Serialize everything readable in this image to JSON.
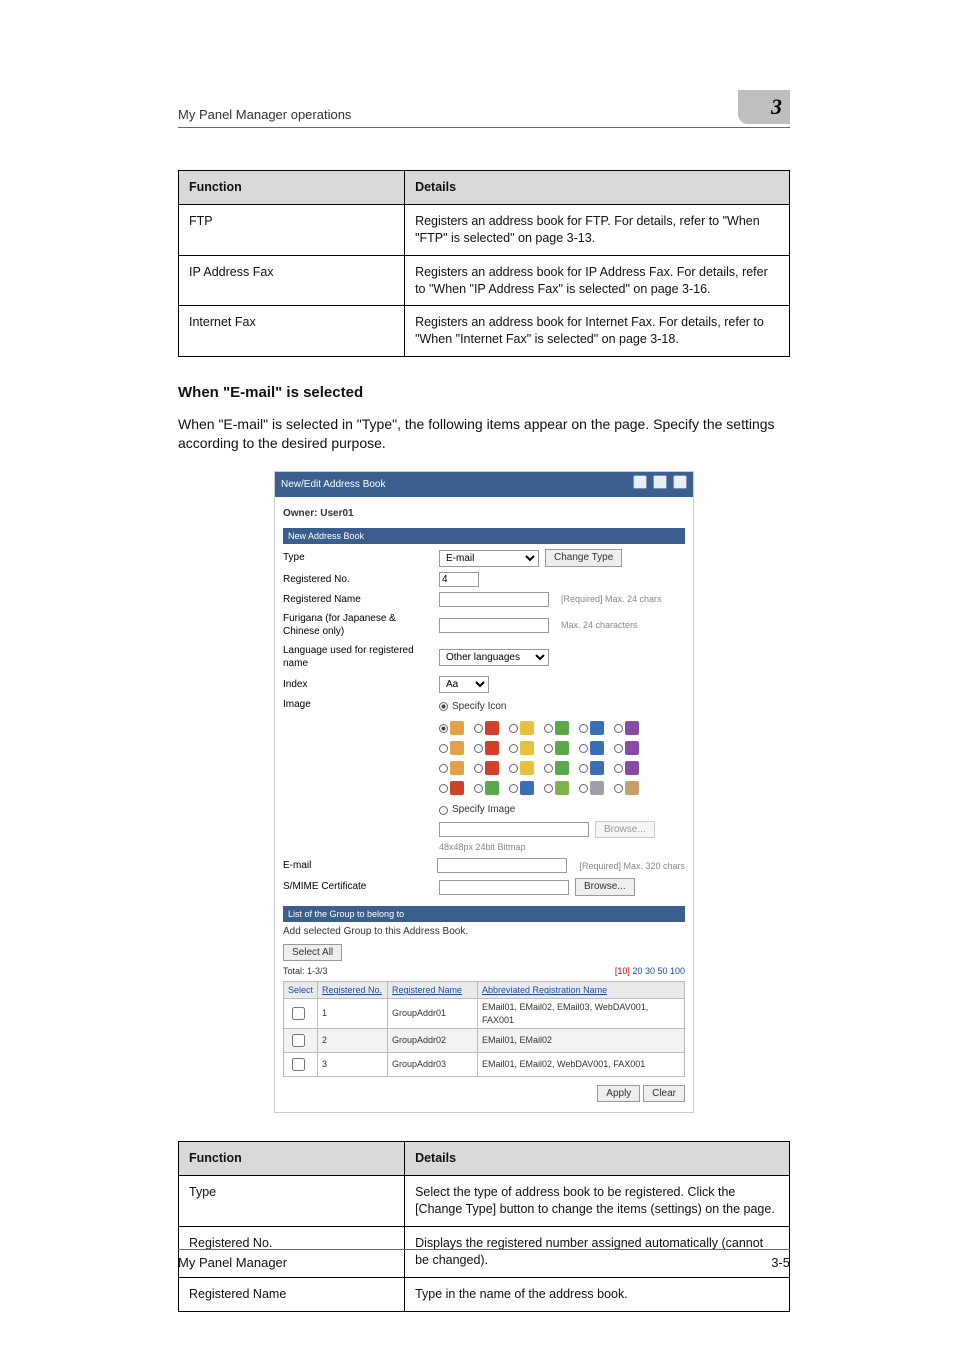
{
  "header": {
    "running_title": "My Panel Manager operations",
    "chapter_number": "3"
  },
  "tables": {
    "top": {
      "head": {
        "fn": "Function",
        "det": "Details"
      },
      "rows": [
        {
          "fn": "FTP",
          "det": "Registers an address book for FTP. For details, refer to \"When \"FTP\" is selected\" on page 3-13."
        },
        {
          "fn": "IP Address Fax",
          "det": "Registers an address book for IP Address Fax. For details, refer to \"When \"IP Address Fax\" is selected\" on page 3-16."
        },
        {
          "fn": "Internet Fax",
          "det": "Registers an address book for Internet Fax. For details, refer to \"When \"Internet Fax\" is selected\" on page 3-18."
        }
      ]
    },
    "bottom": {
      "head": {
        "fn": "Function",
        "det": "Details"
      },
      "rows": [
        {
          "fn": "Type",
          "det": "Select the type of address book to be registered. Click the [Change Type] button to change the items (settings) on the page."
        },
        {
          "fn": "Registered No.",
          "det": "Displays the registered number assigned automatically (cannot be changed)."
        },
        {
          "fn": "Registered Name",
          "det": "Type in the name of the address book."
        }
      ]
    }
  },
  "section": {
    "heading": "When \"E-mail\" is selected",
    "paragraph": "When \"E-mail\" is selected in \"Type\", the following items appear on the page. Specify the settings according to the desired purpose."
  },
  "shot": {
    "titlebar": "New/Edit Address Book",
    "owner": "Owner: User01",
    "sub1": "New Address Book",
    "type_lbl": "Type",
    "type_val": "E-mail",
    "change_type_btn": "Change Type",
    "regno_lbl": "Registered No.",
    "regno_val": "4",
    "regname_lbl": "Registered Name",
    "regname_hint": "[Required] Max. 24 chars",
    "furigana_lbl": "Furigana (for Japanese & Chinese only)",
    "furigana_hint": "Max. 24 characters",
    "lang_lbl": "Language used for registered name",
    "lang_val": "Other languages",
    "index_lbl": "Index",
    "index_val": "Aa",
    "image_lbl": "Image",
    "specify_icon": "Specify Icon",
    "specify_image": "Specify Image",
    "browse_btn": "Browse...",
    "bitmap_note": "48x48px 24bit Bitmap",
    "email_lbl": "E-mail",
    "email_hint": "[Required] Max. 320 chars",
    "smime_lbl": "S/MIME Certificate",
    "sub2": "List of the Group to belong to",
    "sub2_note": "Add selected Group to this Address Book.",
    "select_all_btn": "Select All",
    "total_lbl": "Total:",
    "total_range": "1-3/3",
    "pager": "[10] 20 30 50 100",
    "grid_head": {
      "sel": "Select",
      "no": "Registered No.",
      "name": "Registered Name",
      "abbr": "Abbreviated Registration Name"
    },
    "grid_rows": [
      {
        "no": "1",
        "name": "GroupAddr01",
        "abbr": "EMail01, EMail02, EMail03, WebDAV001, FAX001"
      },
      {
        "no": "2",
        "name": "GroupAddr02",
        "abbr": "EMail01, EMail02"
      },
      {
        "no": "3",
        "name": "GroupAddr03",
        "abbr": "EMail01, EMail02, WebDAV001, FAX001"
      }
    ],
    "apply_btn": "Apply",
    "clear_btn": "Clear"
  },
  "footer": {
    "left": "My Panel Manager",
    "right": "3-5"
  }
}
